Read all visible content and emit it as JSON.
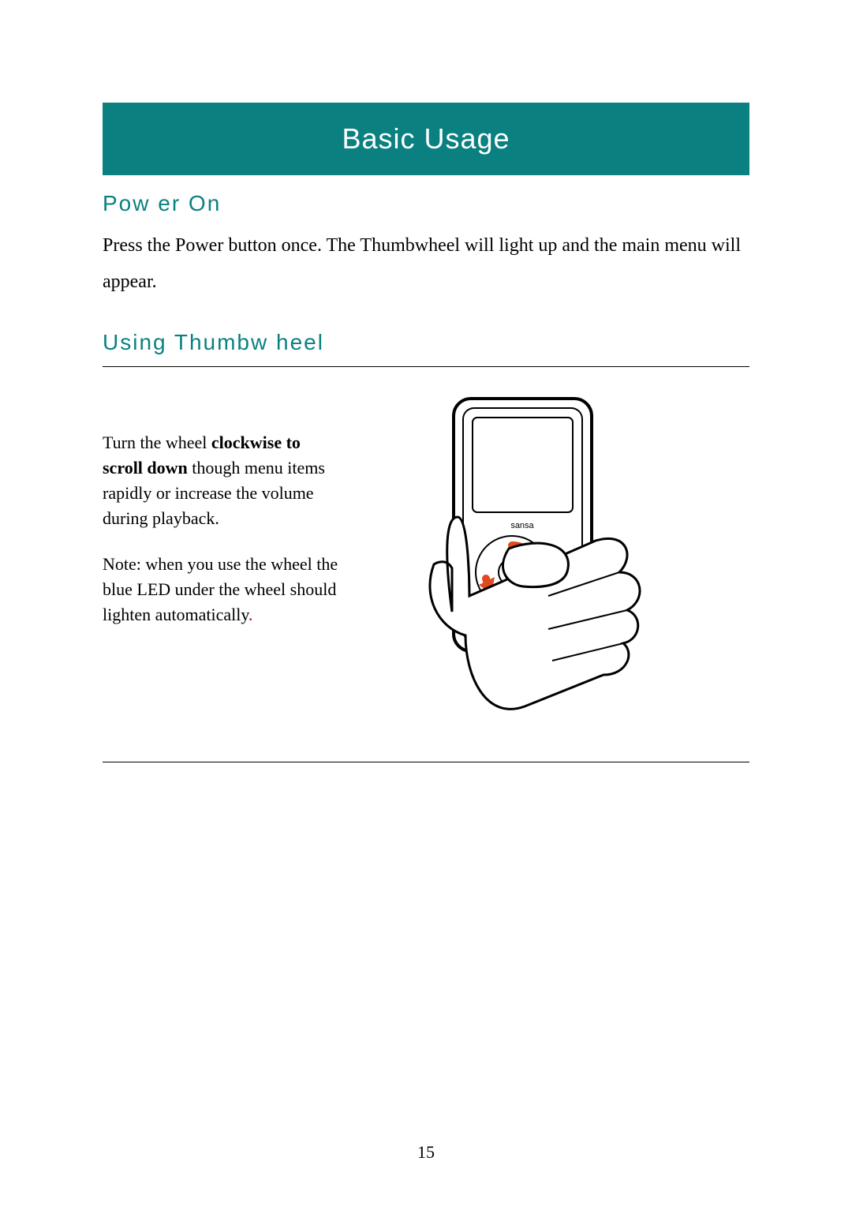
{
  "banner": "Basic Usage",
  "section1": {
    "heading": "Pow er On",
    "text": "Press the Power button once.    The Thumbwheel will light up and the main menu will appear."
  },
  "section2": {
    "heading": "Using Thumbw heel",
    "para1_pre": "Turn the wheel ",
    "para1_bold": "clockwise to scroll down",
    "para1_post": " though menu items rapidly or increase the volume during playback.",
    "note": "Note: when you use the wheel the blue LED under the wheel should lighten automatically",
    "note_dot": "."
  },
  "device_label": "sansa",
  "page_number": "15"
}
